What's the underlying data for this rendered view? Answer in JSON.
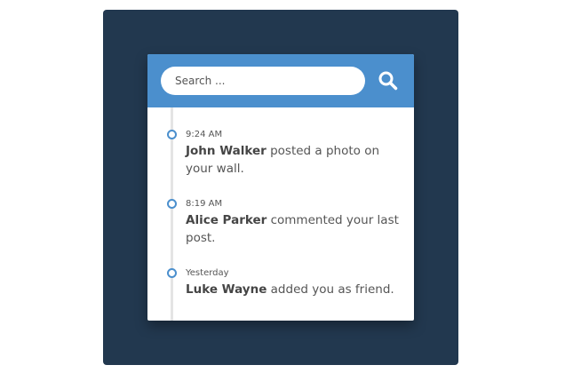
{
  "search": {
    "placeholder": "Search ..."
  },
  "icons": {
    "search": "search-icon"
  },
  "colors": {
    "background": "#22384f",
    "header": "#4b8fcd",
    "accent": "#4b8fcd"
  },
  "feed": [
    {
      "time": "9:24 AM",
      "name": "John Walker",
      "action": "posted a photo on your wall."
    },
    {
      "time": "8:19 AM",
      "name": "Alice Parker",
      "action": "commented your last post."
    },
    {
      "time": "Yesterday",
      "name": "Luke Wayne",
      "action": "added you as friend."
    }
  ]
}
